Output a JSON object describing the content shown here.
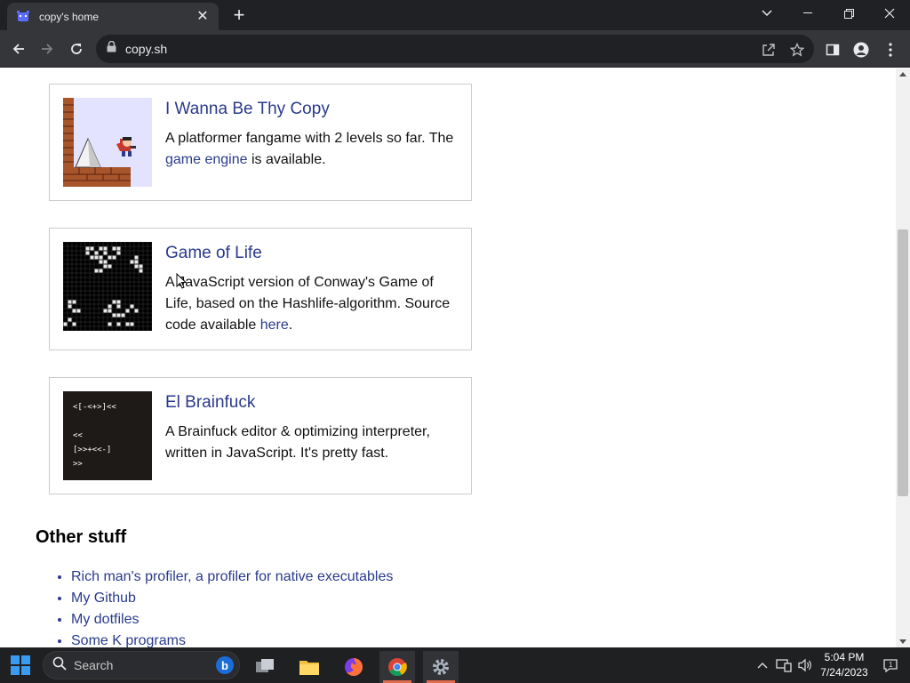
{
  "browser": {
    "tab_title": "copy's home",
    "url": "copy.sh"
  },
  "cards": [
    {
      "title": "I Wanna Be Thy Copy",
      "desc_pre": "A platformer fangame with 2 levels so far. The ",
      "desc_link": "game engine",
      "desc_post": " is available."
    },
    {
      "title": "Game of Life",
      "desc_pre": "A JavaScript version of Conway's Game of Life, based on the Hashlife-algorithm. Source code available ",
      "desc_link": "here",
      "desc_post": "."
    },
    {
      "title": "El Brainfuck",
      "desc": "A Brainfuck editor & optimizing interpreter, written in JavaScript. It's pretty fast.",
      "thumb_code": "<[-<+>]<<\n\n<<\n[>>+<<-]\n>>"
    }
  ],
  "other_stuff": {
    "heading": "Other stuff",
    "links": [
      "Rich man's profiler, a profiler for native executables",
      "My Github",
      "My dotfiles",
      "Some K programs"
    ]
  },
  "taskbar": {
    "search_placeholder": "Search",
    "time": "5:04 PM",
    "date": "7/24/2023"
  },
  "colors": {
    "link": "#2a3a8c",
    "browser_frame": "#202124",
    "toolbar": "#35363a"
  }
}
